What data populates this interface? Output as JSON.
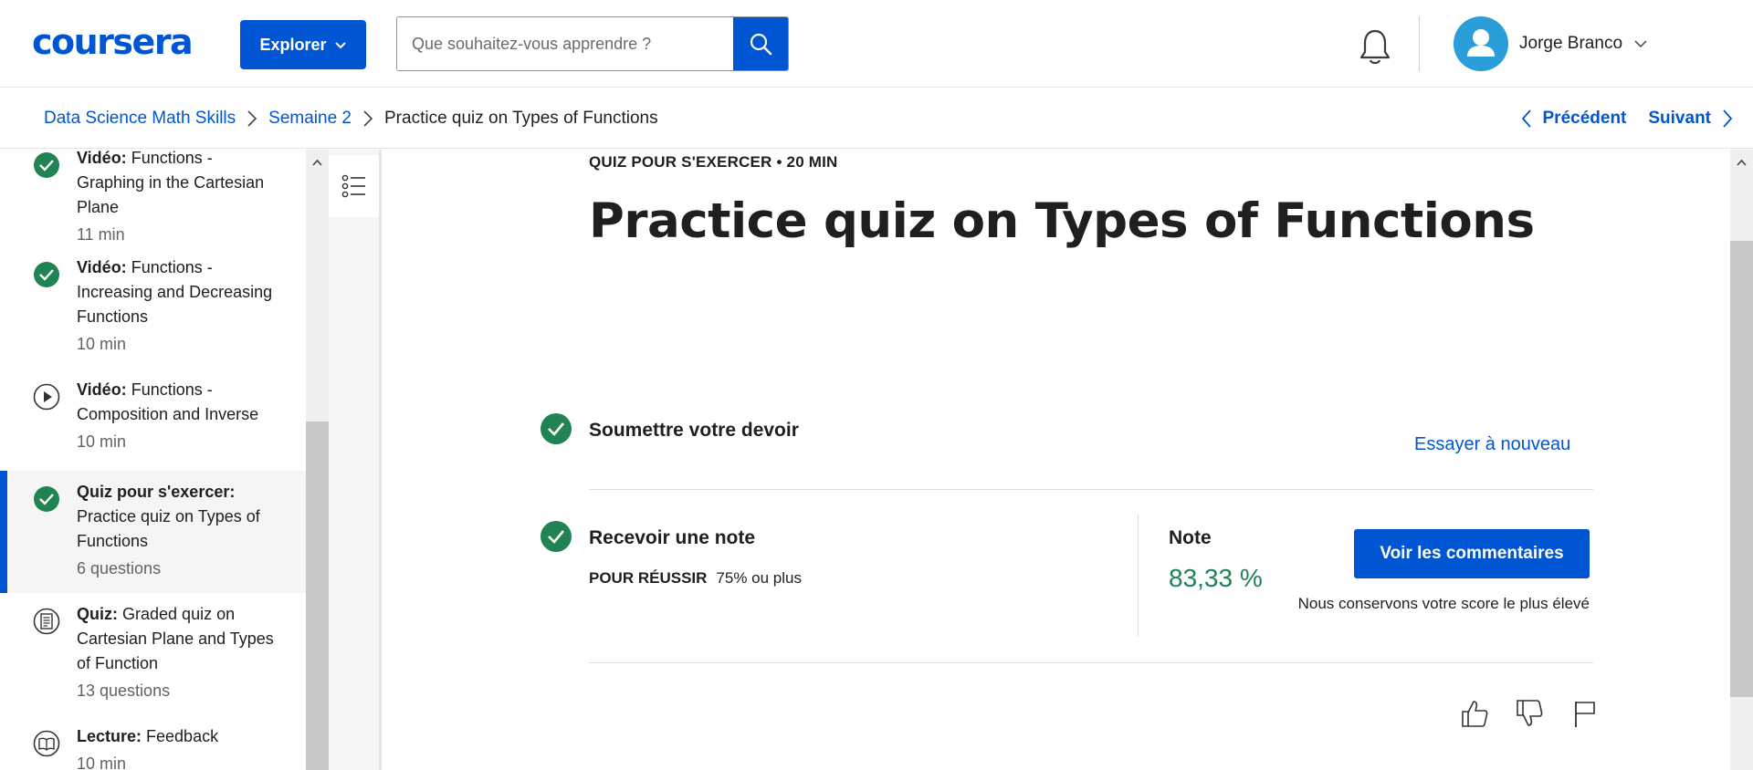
{
  "header": {
    "logo": "coursera",
    "explore_label": "Explorer",
    "search_placeholder": "Que souhaitez-vous apprendre ?",
    "user_name": "Jorge Branco"
  },
  "breadcrumb": {
    "items": [
      "Data Science Math Skills",
      "Semaine 2",
      "Practice quiz on Types of Functions"
    ],
    "prev_label": "Précédent",
    "next_label": "Suivant"
  },
  "sidebar": {
    "items": [
      {
        "type": "Vidéo:",
        "title": "Functions - Graphing in the Cartesian Plane",
        "duration": "11 min",
        "icon": "check-icon"
      },
      {
        "type": "Vidéo:",
        "title": "Functions - Increasing and Decreasing Functions",
        "duration": "10 min",
        "icon": "check-icon"
      },
      {
        "type": "Vidéo:",
        "title": "Functions - Composition and Inverse",
        "duration": "10 min",
        "icon": "play-icon"
      },
      {
        "type": "Quiz pour s'exercer:",
        "title": "Practice quiz on Types of Functions",
        "duration": "6 questions",
        "icon": "check-icon"
      },
      {
        "type": "Quiz:",
        "title": "Graded quiz on Cartesian Plane and Types of Function",
        "duration": "13 questions",
        "icon": "quiz-icon"
      },
      {
        "type": "Lecture:",
        "title": "Feedback",
        "duration": "10 min",
        "icon": "book-icon"
      }
    ]
  },
  "main": {
    "kicker": "QUIZ POUR S'EXERCER • 20 MIN",
    "title": "Practice quiz on Types of Functions",
    "submit_label": "Soumettre votre devoir",
    "retry_label": "Essayer à nouveau",
    "receive_grade_label": "Recevoir une note",
    "pass_label": "POUR RÉUSSIR",
    "pass_value": "75% ou plus",
    "note_label": "Note",
    "note_value": "83,33 %",
    "feedback_button": "Voir les commentaires",
    "keep_note": "Nous conservons votre score le plus élevé"
  },
  "colors": {
    "brand": "#0056d2",
    "success": "#1f8354"
  }
}
